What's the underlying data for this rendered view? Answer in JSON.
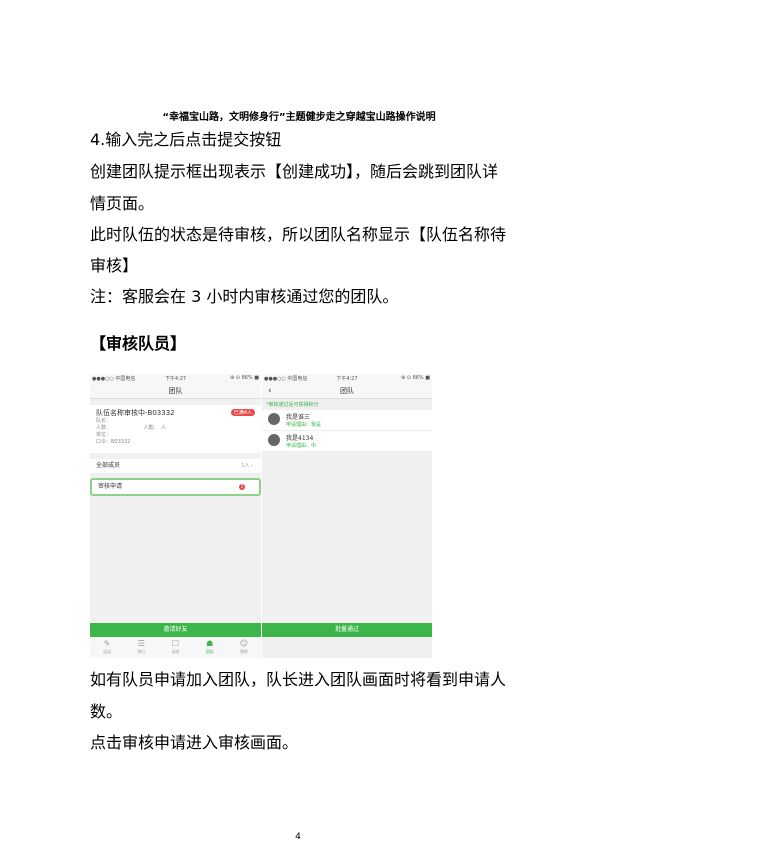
{
  "header_title": "“幸福宝山路，文明修身行”主题健步走之穿越宝山路操作说明",
  "paragraphs": [
    "4.输入完之后点击提交按钮",
    "创建团队提示框出现表示【创建成功】，随后会跳到团队详",
    "情页面。",
    "此时队伍的状态是待审核，所以团队名称显示【队伍名称待",
    "审核】",
    "注：客服会在 3 小时内审核通过您的团队。"
  ],
  "section_title": "【审核队员】",
  "bottom_paragraphs": [
    "如有队员申请加入团队，队长进入团队画面时将看到申请人",
    "数。",
    "点击审核申请进入审核画面。"
  ],
  "page_number": "4",
  "screen_left": {
    "status_carrier": "●●●○○ 中国电信",
    "status_time": "下午4:27",
    "status_right": "⊕ ⊙ 86% ■",
    "nav_title": "团队",
    "team_name": "队伍名称审核中-B03332",
    "team_badge": "已满4人",
    "team_lines": [
      "队长：",
      "人数：　　　　　　　人数：　人",
      "单位：　　　　　　　　　　",
      "口令：B03332"
    ],
    "row_all_members": "全部成员",
    "row_all_members_value": "1人 ›",
    "row_review": "审核申请",
    "row_review_count": "2",
    "green_button": "邀请好友",
    "tabs": [
      "运动",
      "排行",
      "动态",
      "团队",
      "我的"
    ]
  },
  "screen_right": {
    "status_carrier": "●●●○○ 中国电信",
    "status_time": "下午4:27",
    "status_right": "⊕ ⊙ 86% ■",
    "nav_back": "‹",
    "nav_title": "团队",
    "info_bar": "*审核通过后可获得积分",
    "members": [
      {
        "name": "我是谁三",
        "reason": "申请理由：我是"
      },
      {
        "name": "我是4134",
        "reason": "申请理由：中"
      }
    ],
    "green_button": "批量通过"
  },
  "colors": {
    "green": "#3cb54a",
    "red": "#e84a4a",
    "highlight": "#8fd08a"
  }
}
